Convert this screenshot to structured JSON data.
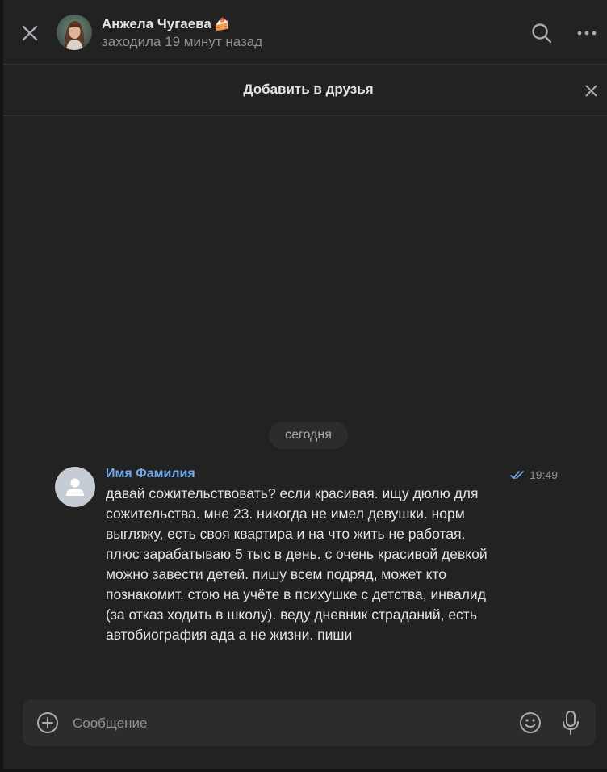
{
  "header": {
    "name": "Анжела Чугаева",
    "name_emoji": "🍰",
    "status": "заходила 19 минут назад",
    "icons": {
      "close": "close-icon",
      "search": "search-icon",
      "more": "more-icon"
    }
  },
  "banner": {
    "label": "Добавить в друзья",
    "close_icon": "close-icon"
  },
  "chat": {
    "date_label": "сегодня",
    "messages": [
      {
        "author": "Имя Фамилия",
        "time": "19:49",
        "read_icon": "double-check-icon",
        "text": "давай сожительствовать? если красивая. ищу дюлю для сожительства. мне 23. никогда не имел девушки. норм выгляжу, есть своя квартира и на что жить не работая. плюс зарабатываю 5 тыс в день. с очень красивой девкой можно завести детей. пишу всем подряд, может кто познакомит. стою на учёте в психушке с детства, инвалид (за отказ ходить в школу). веду дневник страданий, есть автобиография ада а не жизни. пиши"
      }
    ]
  },
  "composer": {
    "placeholder": "Сообщение",
    "value": "",
    "icons": {
      "attach": "add-circle-icon",
      "emoji": "smile-icon",
      "mic": "microphone-icon"
    }
  },
  "colors": {
    "background": "#222222",
    "accent": "#71aaeb",
    "text": "#e1e3e6",
    "secondary_text": "#8e9196"
  }
}
